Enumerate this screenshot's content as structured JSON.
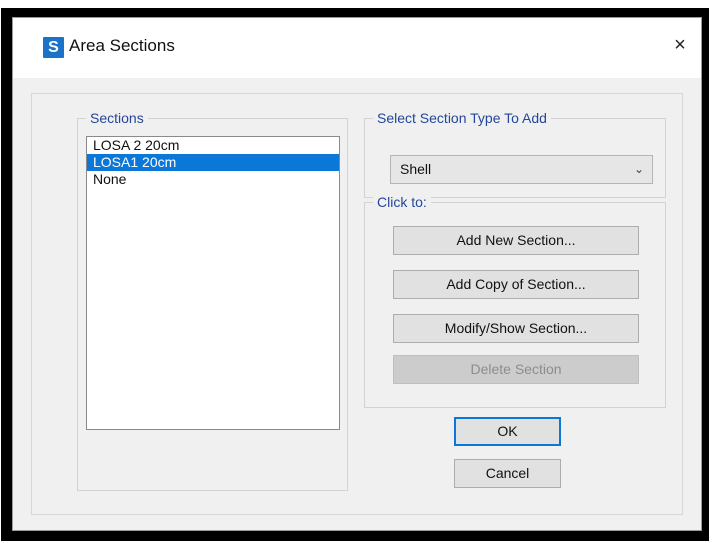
{
  "window": {
    "app_icon_letter": "S",
    "title": "Area Sections",
    "close_glyph": "×"
  },
  "sections": {
    "label": "Sections",
    "items": [
      "LOSA 2 20cm",
      "LOSA1 20cm",
      "None"
    ],
    "selected_index": 1
  },
  "section_type": {
    "label": "Select Section Type To Add",
    "value": "Shell"
  },
  "click_to": {
    "label": "Click to:",
    "add_new": "Add New Section...",
    "add_copy": "Add Copy of Section...",
    "modify_show": "Modify/Show Section...",
    "delete": "Delete Section"
  },
  "footer": {
    "ok": "OK",
    "cancel": "Cancel"
  },
  "colors": {
    "accent": "#0a77d9",
    "group_label": "#23479a"
  }
}
